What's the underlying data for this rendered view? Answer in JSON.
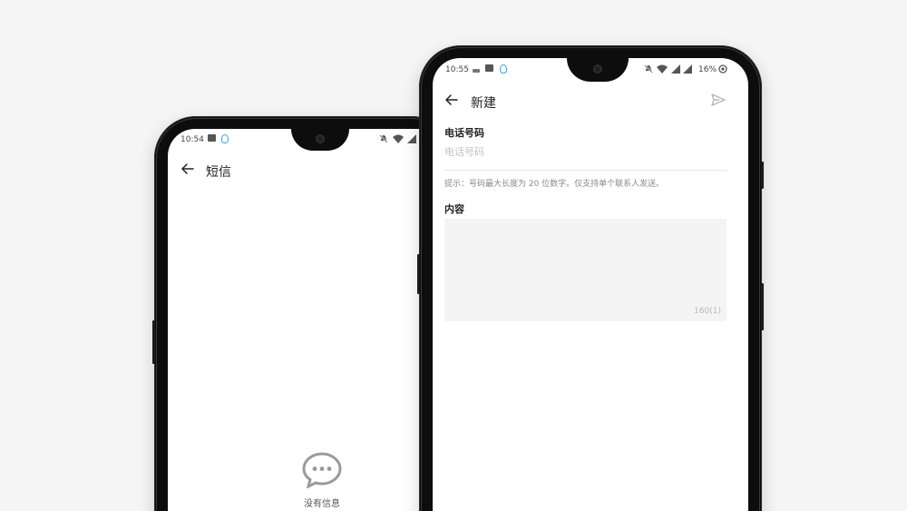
{
  "left_phone": {
    "status_bar": {
      "time": "10:54"
    },
    "header": {
      "title": "短信"
    },
    "empty_state": {
      "text": "没有信息"
    }
  },
  "right_phone": {
    "status_bar": {
      "time": "10:55",
      "battery": "16%"
    },
    "header": {
      "title": "新建"
    },
    "phone_field": {
      "label": "电话号码",
      "placeholder": "电话号码"
    },
    "hint": "提示：号码最大长度为 20 位数字。仅支持单个联系人发送。",
    "content_field": {
      "label": "内容",
      "counter": "160(1)"
    }
  },
  "icons": {
    "back": "arrow-left-icon",
    "send": "send-icon",
    "image": "image-icon",
    "qq": "qq-icon",
    "mute": "bell-off-icon",
    "wifi": "wifi-icon",
    "signal": "signal-icon",
    "battery": "battery-icon",
    "chat": "chat-bubble-icon"
  },
  "colors": {
    "background": "#f5f5f5",
    "phone_frame": "#0d0d0d",
    "screen": "#ffffff",
    "content_box": "#f4f4f4",
    "qq_accent": "#3aa0e6"
  }
}
